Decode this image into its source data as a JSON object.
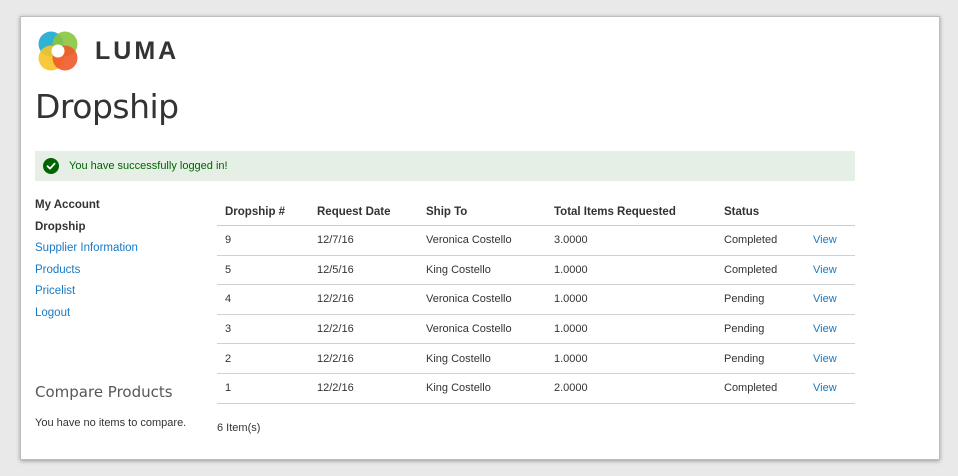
{
  "header": {
    "logo_text": "LUMA"
  },
  "page_title": "Dropship",
  "message": "You have successfully logged in!",
  "sidebar": {
    "items": [
      {
        "label": "My Account",
        "style": "bold"
      },
      {
        "label": "Dropship",
        "style": "bold"
      },
      {
        "label": "Supplier Information",
        "style": "link"
      },
      {
        "label": "Products",
        "style": "link"
      },
      {
        "label": "Pricelist",
        "style": "link"
      },
      {
        "label": "Logout",
        "style": "link"
      }
    ]
  },
  "compare": {
    "title": "Compare Products",
    "empty_text": "You have no items to compare."
  },
  "table": {
    "headers": [
      "Dropship #",
      "Request Date",
      "Ship To",
      "Total Items Requested",
      "Status",
      ""
    ],
    "rows": [
      [
        "9",
        "12/7/16",
        "Veronica Costello",
        "3.0000",
        "Completed",
        "View"
      ],
      [
        "5",
        "12/5/16",
        "King Costello",
        "1.0000",
        "Completed",
        "View"
      ],
      [
        "4",
        "12/2/16",
        "Veronica Costello",
        "1.0000",
        "Pending",
        "View"
      ],
      [
        "3",
        "12/2/16",
        "Veronica Costello",
        "1.0000",
        "Pending",
        "View"
      ],
      [
        "2",
        "12/2/16",
        "King Costello",
        "1.0000",
        "Pending",
        "View"
      ],
      [
        "1",
        "12/2/16",
        "King Costello",
        "2.0000",
        "Completed",
        "View"
      ]
    ]
  },
  "item_count": "6 Item(s)",
  "colors": {
    "link": "#1979c3",
    "success_bg": "#e5efe5",
    "success_text": "#006400",
    "text": "#333333"
  },
  "icons": {
    "success": "check-circle-icon",
    "logo": "luma-logo-icon"
  }
}
